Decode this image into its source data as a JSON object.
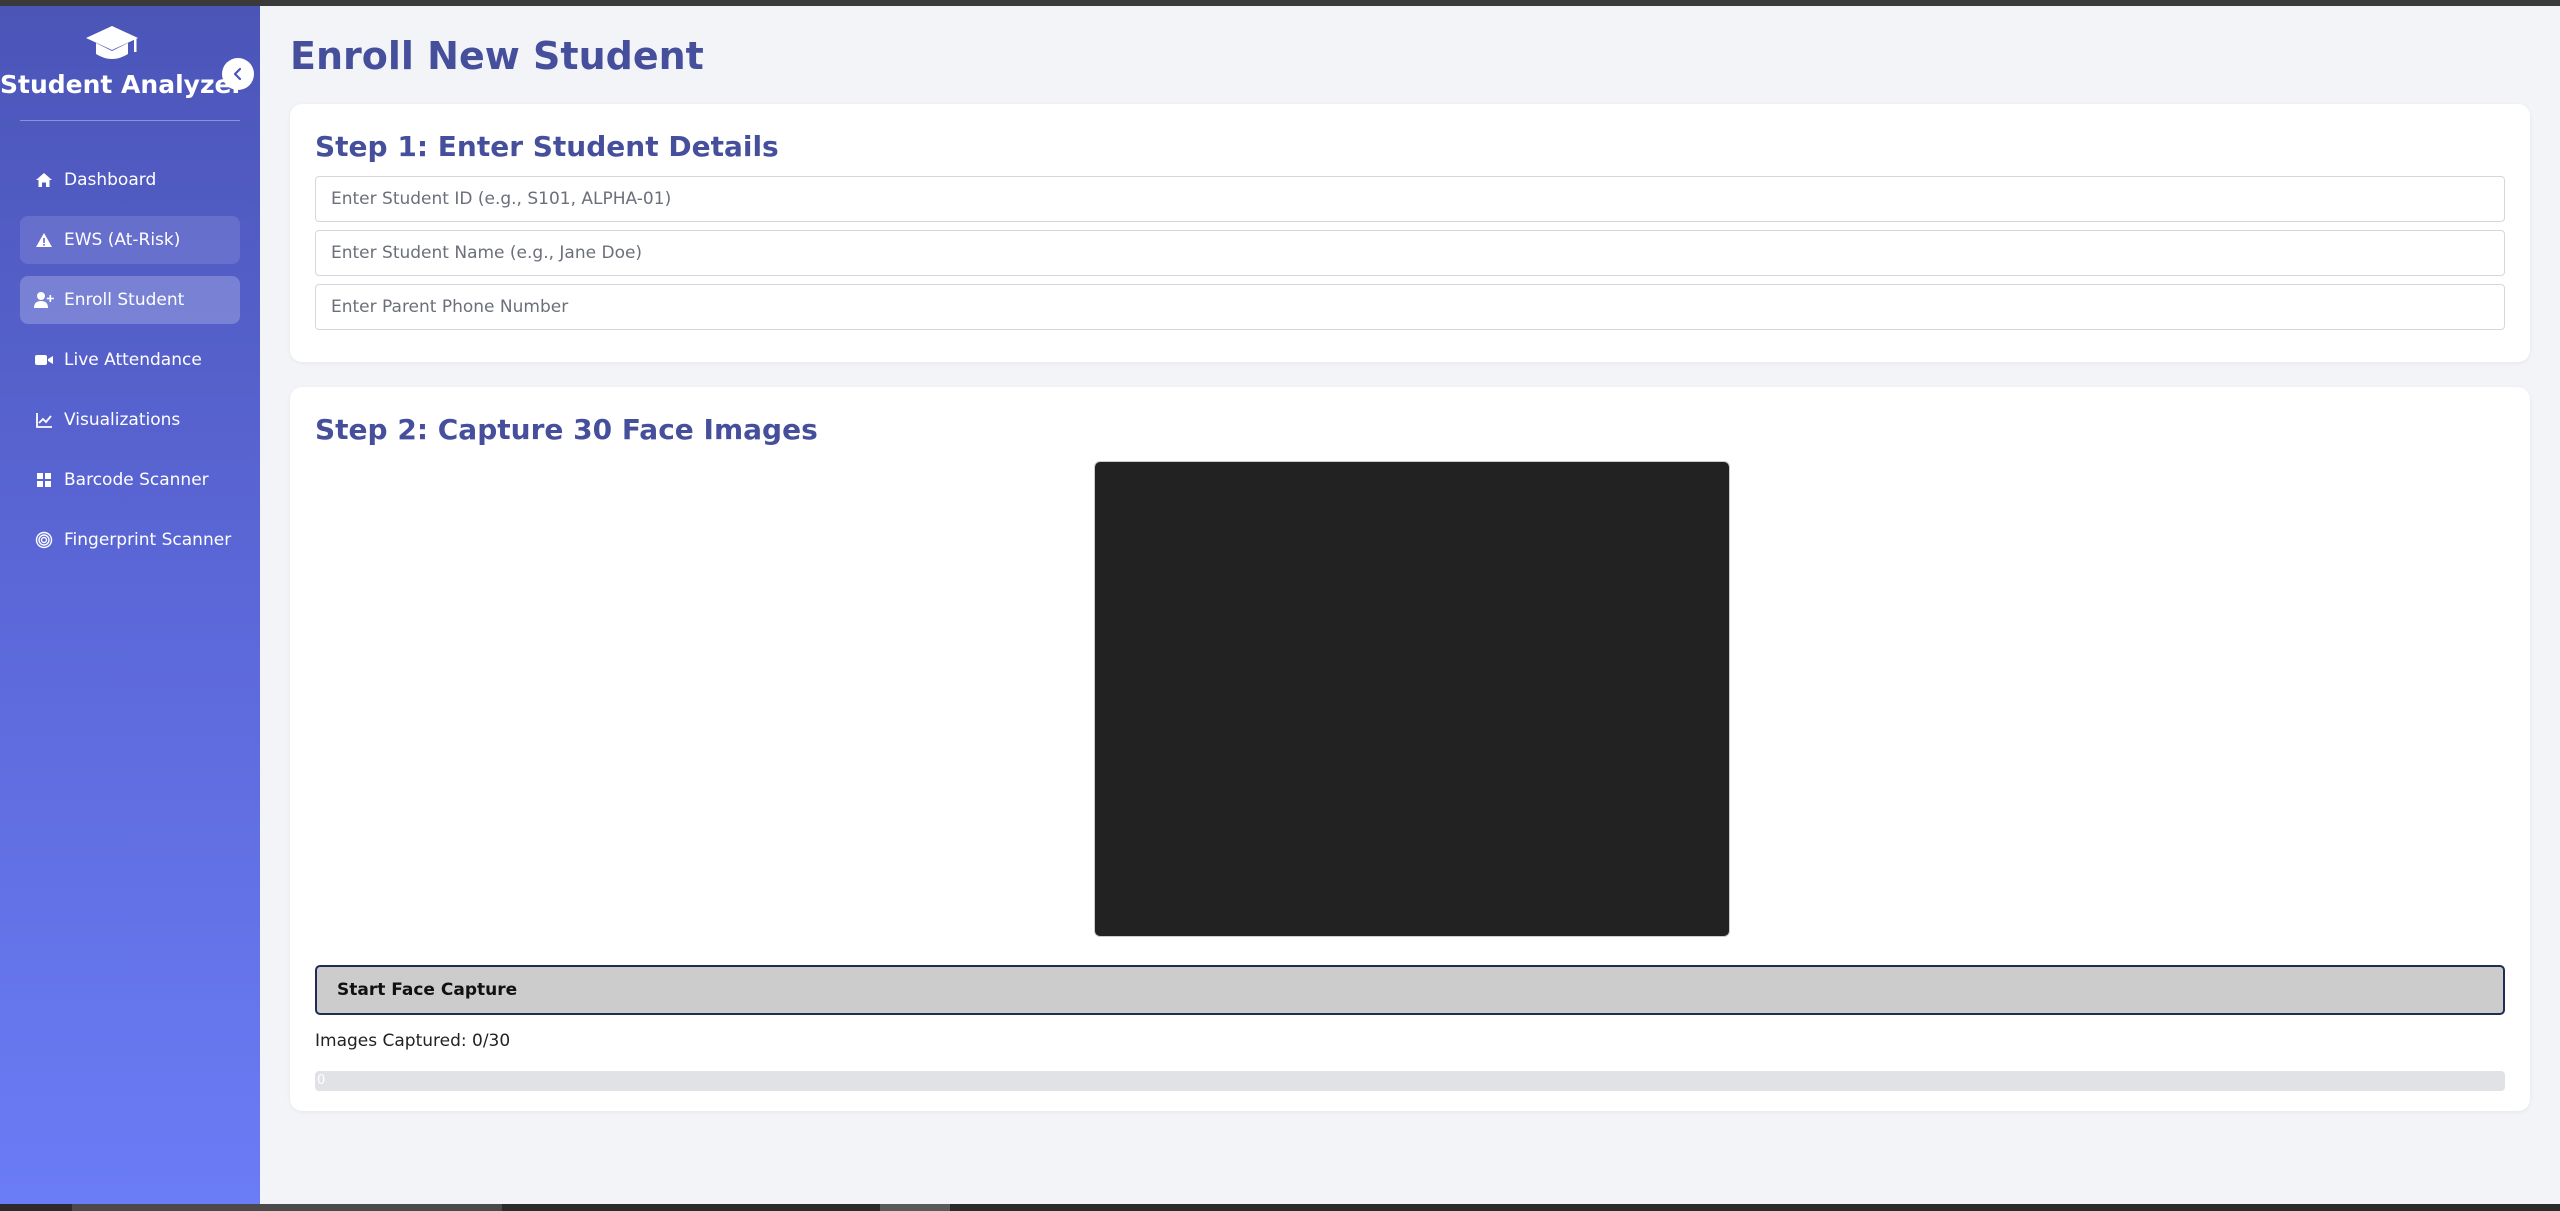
{
  "sidebar": {
    "brand_title": "Student Analyzer",
    "items": [
      {
        "label": "Dashboard",
        "icon": "home-icon"
      },
      {
        "label": "EWS (At-Risk)",
        "icon": "warning-icon"
      },
      {
        "label": "Enroll Student",
        "icon": "user-plus-icon"
      },
      {
        "label": "Live Attendance",
        "icon": "video-camera-icon"
      },
      {
        "label": "Visualizations",
        "icon": "chart-icon"
      },
      {
        "label": "Barcode Scanner",
        "icon": "grid-icon"
      },
      {
        "label": "Fingerprint Scanner",
        "icon": "fingerprint-icon"
      }
    ],
    "active_item": "Enroll Student"
  },
  "main": {
    "page_title": "Enroll New Student",
    "step1": {
      "title": "Step 1: Enter Student Details",
      "student_id_placeholder": "Enter Student ID (e.g., S101, ALPHA-01)",
      "student_name_placeholder": "Enter Student Name (e.g., Jane Doe)",
      "parent_phone_placeholder": "Enter Parent Phone Number"
    },
    "step2": {
      "title": "Step 2: Capture 30 Face Images",
      "capture_button": "Start Face Capture",
      "captured_text": "Images Captured: 0/30",
      "progress_label": "0",
      "progress_value": 0
    }
  },
  "colors": {
    "accent": "#454f9c",
    "sidebar_top": "#4b55b8",
    "sidebar_bottom": "#6a7cf6",
    "camera_bg": "#222222"
  }
}
